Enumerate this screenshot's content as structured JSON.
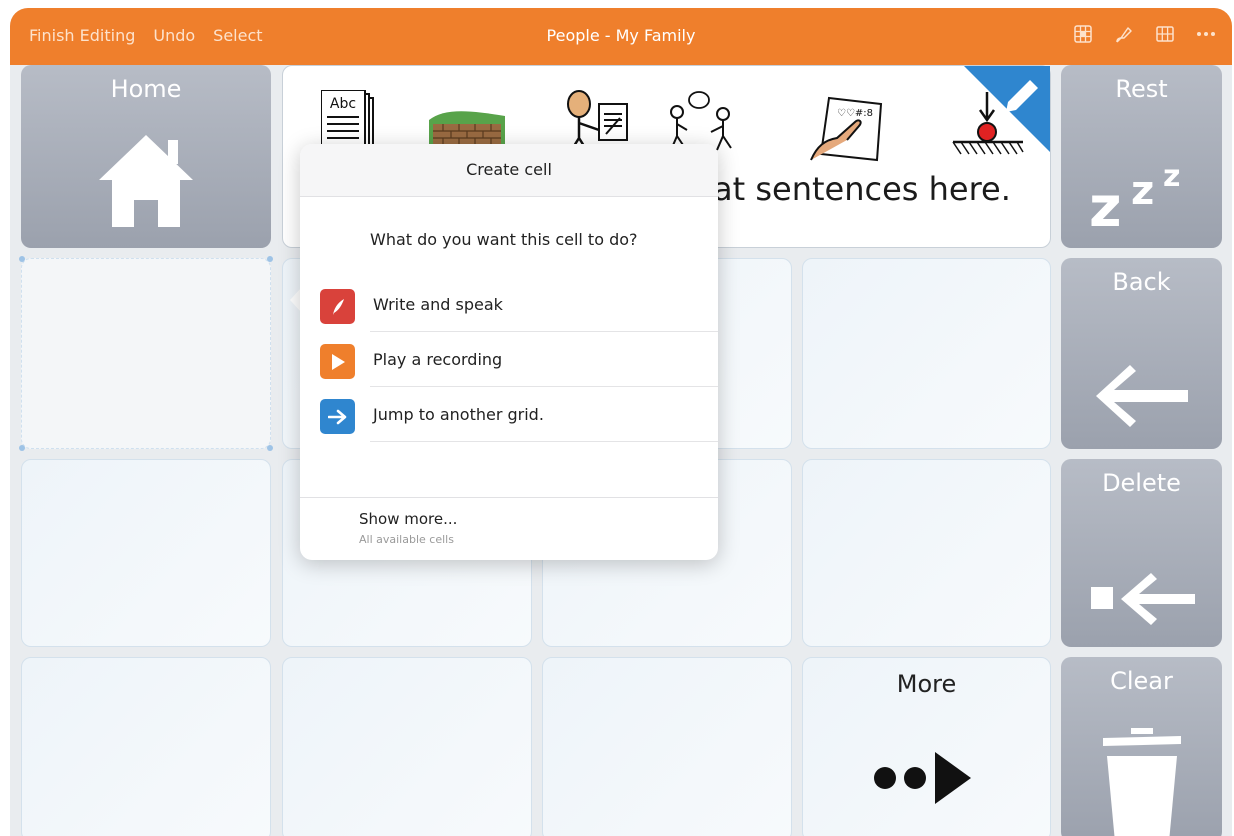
{
  "toolbar": {
    "finish_editing": "Finish Editing",
    "undo": "Undo",
    "select": "Select",
    "title": "People - My Family",
    "icons": [
      "grid-fill-icon",
      "brush-icon",
      "grid-icon",
      "more-icon"
    ],
    "color": "#ef7f2c"
  },
  "cells": {
    "home": "Home",
    "rest": "Rest",
    "back": "Back",
    "delete": "Delete",
    "clear": "Clear",
    "more": "More",
    "sentence_text": "at sentences here."
  },
  "popover": {
    "title": "Create cell",
    "question": "What do you want this cell to do?",
    "options": [
      {
        "label": "Write and speak",
        "icon": "quill-icon",
        "color": "#d9423b"
      },
      {
        "label": "Play a recording",
        "icon": "play-icon",
        "color": "#ef7f2c"
      },
      {
        "label": "Jump to another grid.",
        "icon": "arrow-right-icon",
        "color": "#2f86cf"
      }
    ],
    "show_more": "Show more...",
    "show_more_sub": "All available cells"
  }
}
